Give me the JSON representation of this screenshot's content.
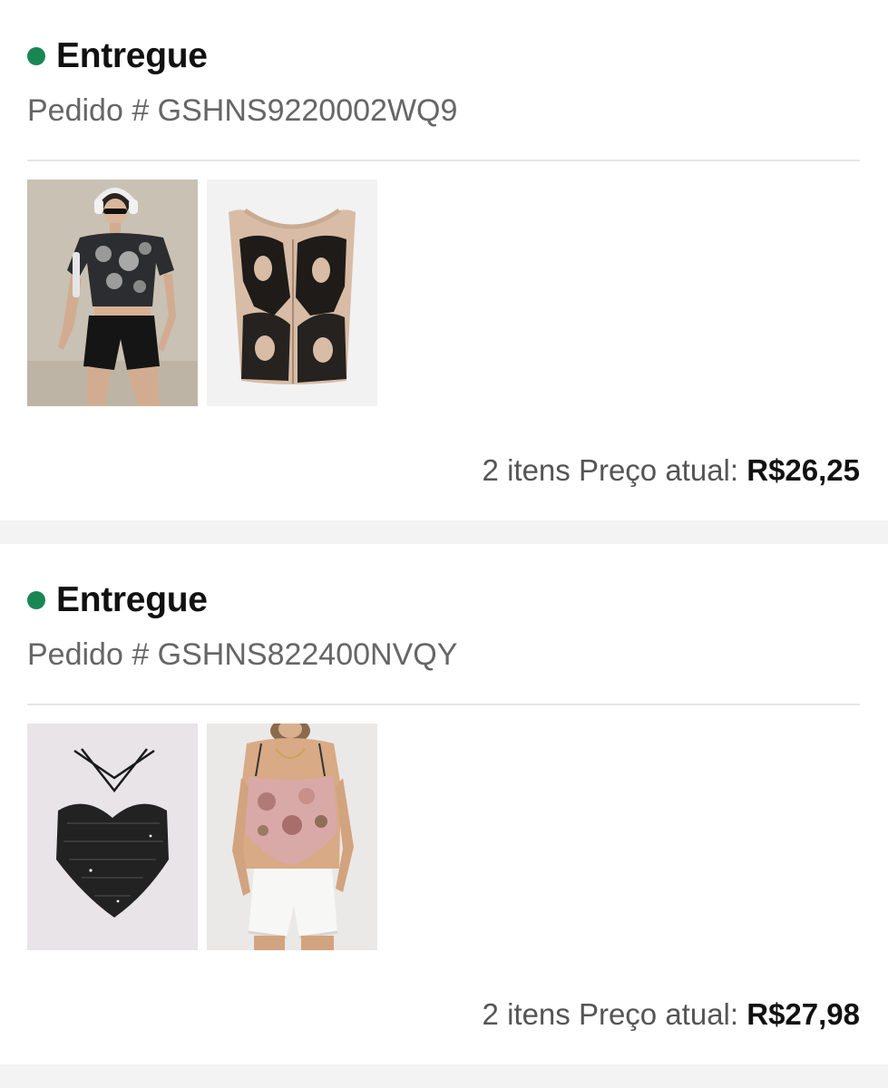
{
  "colors": {
    "status_dot": "#198754",
    "page_background": "#f3f3f3",
    "card_background": "#ffffff"
  },
  "orders": [
    {
      "status": "Entregue",
      "order_number": "Pedido # GSHNS9220002WQ9",
      "items": [
        {
          "image": "model-graphic-crop-tee-photo"
        },
        {
          "image": "graphic-print-tank-top-photo"
        }
      ],
      "item_count": "2 itens",
      "price_label": "Preço atual:",
      "price": "R$26,25"
    },
    {
      "status": "Entregue",
      "order_number": "Pedido # GSHNS822400NVQY",
      "items": [
        {
          "image": "black-halter-top-photo"
        },
        {
          "image": "model-floral-halter-top-photo"
        }
      ],
      "item_count": "2 itens",
      "price_label": "Preço atual:",
      "price": "R$27,98"
    }
  ]
}
